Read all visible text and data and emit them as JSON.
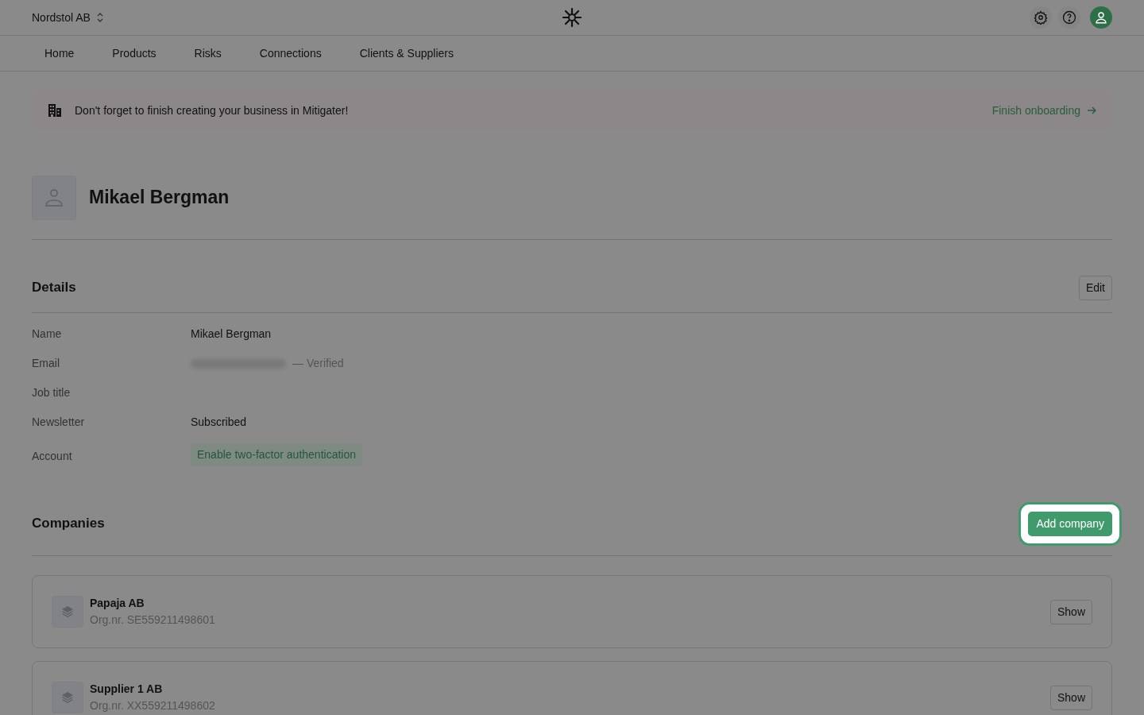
{
  "topbar": {
    "organization": "Nordstol AB"
  },
  "nav": [
    {
      "label": "Home",
      "selected": false
    },
    {
      "label": "Products",
      "selected": false
    },
    {
      "label": "Risks",
      "selected": false
    },
    {
      "label": "Connections",
      "selected": false
    },
    {
      "label": "Clients & Suppliers",
      "selected": false
    }
  ],
  "banner": {
    "message": "Don't forget to finish creating your business in Mitigater!",
    "action": "Finish onboarding"
  },
  "profile": {
    "name": "Mikael Bergman"
  },
  "details": {
    "title": "Details",
    "edit_button": "Edit",
    "rows": [
      {
        "label": "Name",
        "kind": "text",
        "value": "Mikael Bergman"
      },
      {
        "label": "Email",
        "kind": "email",
        "note": "— Verified"
      },
      {
        "label": "Job title",
        "kind": "empty"
      },
      {
        "label": "Newsletter",
        "kind": "text",
        "value": "Subscribed"
      },
      {
        "label": "Account",
        "kind": "action",
        "value": "Enable two-factor authentication"
      }
    ]
  },
  "companies": {
    "title": "Companies",
    "add_button": {
      "label": "Add company",
      "spotlight": true
    },
    "items": [
      {
        "name": "Papaja AB",
        "org": "Org.nr. SE559211498601",
        "button": "Show"
      },
      {
        "name": "Supplier 1 AB",
        "org": "Org.nr. XX559211498602",
        "button": "Show"
      }
    ]
  }
}
